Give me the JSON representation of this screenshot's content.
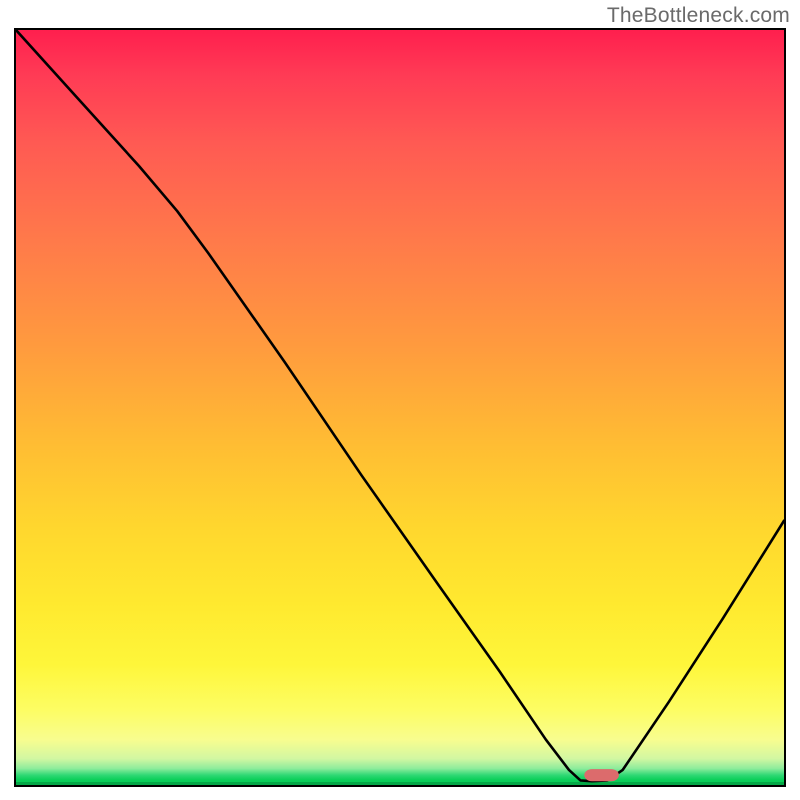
{
  "watermark": "TheBottleneck.com",
  "colors": {
    "gradient_top": "#ff1f4e",
    "gradient_mid": "#ffe92f",
    "gradient_bottom": "#04cc54",
    "curve": "#000000",
    "marker": "#dc6b6c",
    "border": "#000000"
  },
  "chart_data": {
    "type": "line",
    "title": "",
    "xlabel": "",
    "ylabel": "",
    "x_range": [
      0,
      100
    ],
    "y_range": [
      0,
      100
    ],
    "note": "x is normalized horizontal position across the plot (0=left,100=right); y is match/compatibility with 0 at the green baseline (bottom) and 100 at the top red edge. Curve starts at the top-left corner, dips to nearly 0 around x≈73, stays near 0 until x≈77, then rises toward the right edge.",
    "series": [
      {
        "name": "bottleneck-curve",
        "points": [
          {
            "x": 0.0,
            "y": 100.0
          },
          {
            "x": 8.0,
            "y": 91.0
          },
          {
            "x": 16.0,
            "y": 82.0
          },
          {
            "x": 21.0,
            "y": 76.0
          },
          {
            "x": 25.0,
            "y": 70.5
          },
          {
            "x": 35.0,
            "y": 56.0
          },
          {
            "x": 45.0,
            "y": 41.0
          },
          {
            "x": 55.0,
            "y": 26.5
          },
          {
            "x": 63.0,
            "y": 15.0
          },
          {
            "x": 69.0,
            "y": 6.0
          },
          {
            "x": 72.0,
            "y": 2.0
          },
          {
            "x": 73.5,
            "y": 0.6
          },
          {
            "x": 75.0,
            "y": 0.5
          },
          {
            "x": 77.0,
            "y": 0.6
          },
          {
            "x": 79.0,
            "y": 2.0
          },
          {
            "x": 85.0,
            "y": 11.0
          },
          {
            "x": 92.0,
            "y": 22.0
          },
          {
            "x": 100.0,
            "y": 35.0
          }
        ]
      }
    ],
    "marker": {
      "name": "optimal-marker",
      "x_start": 74.0,
      "x_end": 78.5,
      "y": 0.5,
      "height_pct": 1.6
    }
  }
}
